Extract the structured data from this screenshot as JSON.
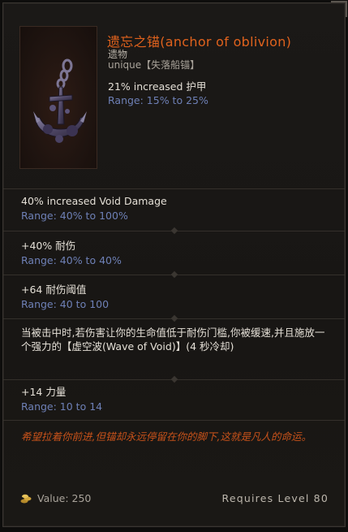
{
  "item": {
    "name": "遗忘之锚(anchor of oblivion)",
    "subtype": "遗物",
    "rarity": "unique【失落船锚】",
    "implicit": "21% increased 护甲",
    "implicit_range": "Range: 15% to 25%"
  },
  "mods": [
    {
      "text": "40% increased Void Damage",
      "range": "Range: 40% to 100%"
    },
    {
      "text": "+40% 耐伤",
      "range": "Range: 40% to 40%"
    },
    {
      "text": "+64 耐伤阈值",
      "range": "Range: 40 to 100"
    },
    {
      "text": "当被击中时,若伤害让你的生命值低于耐伤门槛,你被缓速,并且施放一个强力的【虚空波(Wave of Void)】(4 秒冷却)"
    },
    {
      "text": "+14 力量",
      "range": "Range: 10 to 14"
    }
  ],
  "lore": "希望拉着你前进,但锚却永远停留在你的脚下,这就是凡人的命运。",
  "footer": {
    "value": "Value: 250",
    "requires": "Requires Level 80"
  },
  "colors": {
    "title": "#e0621d",
    "range": "#6e80b6",
    "lore": "#c8521a"
  },
  "icons": [
    "anchor-relic-icon",
    "coin-icon"
  ]
}
